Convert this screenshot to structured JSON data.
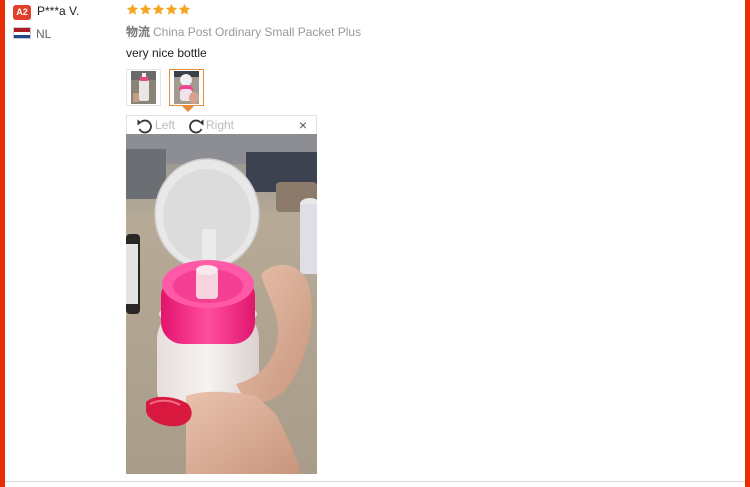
{
  "reviewer": {
    "badge": "A2",
    "name": "P***a V.",
    "country": "NL",
    "flag_icon": "netherlands-flag-icon"
  },
  "review": {
    "rating": 5,
    "rating_max": 5,
    "star_color": "#f5a623",
    "shipping_label": "物流",
    "shipping_method": "China Post Ordinary Small Packet Plus",
    "comment": "very nice bottle"
  },
  "thumbnails": [
    {
      "name": "review-photo-1",
      "selected": false
    },
    {
      "name": "review-photo-2",
      "selected": true
    }
  ],
  "viewer": {
    "rotate_left_label": "Left",
    "rotate_right_label": "Right",
    "close_symbol": "×",
    "rotate_left_icon": "rotate-left-icon",
    "rotate_right_icon": "rotate-right-icon",
    "close_icon": "close-icon"
  },
  "colors": {
    "frame": "#e62e04",
    "selected_border": "#e98b3b",
    "badge": "#e0402b"
  }
}
